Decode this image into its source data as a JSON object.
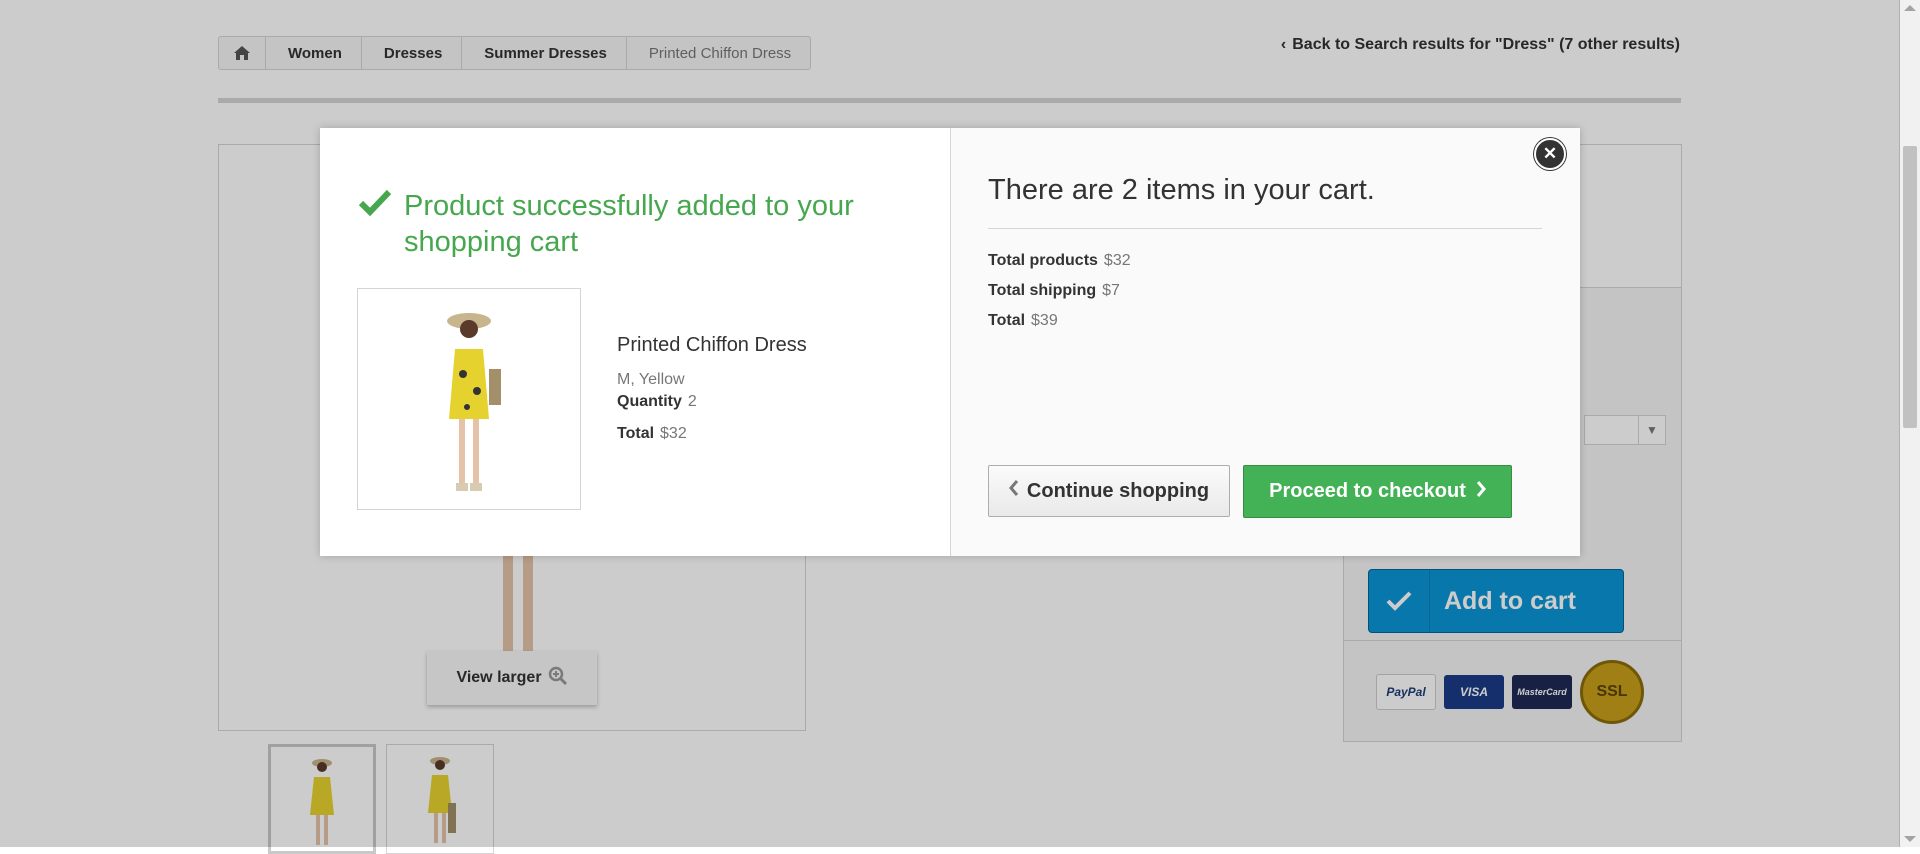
{
  "breadcrumb": {
    "home_icon": "home-icon",
    "items": [
      "Women",
      "Dresses",
      "Summer Dresses",
      "Printed Chiffon Dress"
    ]
  },
  "back_link": "Back to Search results for \"Dress\" (7 other results)",
  "image": {
    "view_larger": "View larger"
  },
  "buy_box": {
    "add_to_cart": "Add to cart"
  },
  "payment_logos": [
    "PayPal",
    "VISA",
    "MasterCard",
    "SSL"
  ],
  "modal": {
    "success_title": "Product successfully added to your shopping cart",
    "product": {
      "name": "Printed Chiffon Dress",
      "attributes": "M, Yellow",
      "quantity_label": "Quantity",
      "quantity": "2",
      "total_label": "Total",
      "total": "$32"
    },
    "cart": {
      "count_text": "There are 2 items in your cart.",
      "total_products_label": "Total products",
      "total_products": "$32",
      "total_shipping_label": "Total shipping",
      "total_shipping": "$7",
      "total_label": "Total",
      "total": "$39"
    },
    "continue_label": "Continue shopping",
    "checkout_label": "Proceed to checkout"
  },
  "colors": {
    "success_green": "#46a74e",
    "checkout_green": "#43b155",
    "add_to_cart_blue": "#0b95d6"
  }
}
